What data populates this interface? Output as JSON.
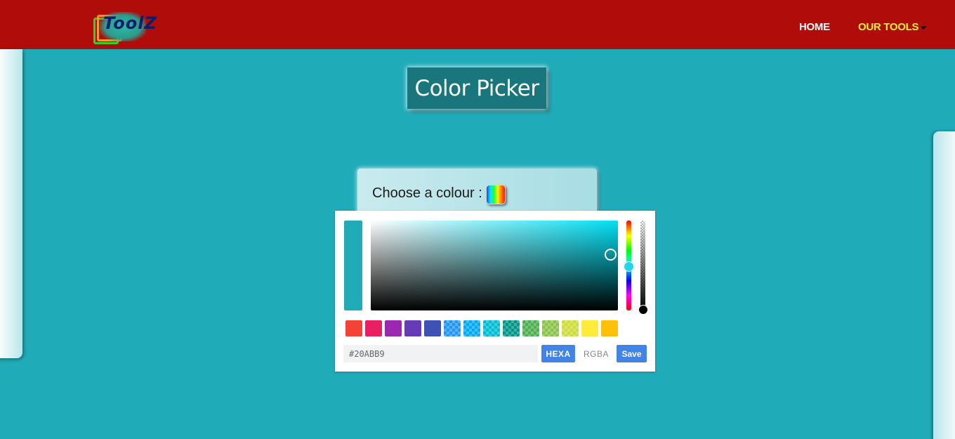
{
  "navbar": {
    "logo_text": "ToolZ",
    "links": [
      {
        "label": "HOME"
      },
      {
        "label": "OUR TOOLS"
      }
    ]
  },
  "page": {
    "title": "Color Picker"
  },
  "chooser": {
    "label": "Choose a colour :"
  },
  "picker": {
    "current_color": "#20ABB9",
    "hue_color": "#00e1f5",
    "hex_value": "#20ABB9",
    "modes": [
      {
        "label": "HEXA",
        "active": true
      },
      {
        "label": "RGBA",
        "active": false
      }
    ],
    "save_label": "Save",
    "swatches": [
      {
        "color": "#f44336",
        "translucent": false
      },
      {
        "color": "#e91e63",
        "translucent": false
      },
      {
        "color": "#9c27b0",
        "translucent": false
      },
      {
        "color": "#673ab7",
        "translucent": false
      },
      {
        "color": "#3f51b5",
        "translucent": false
      },
      {
        "color": "#2196f3",
        "translucent": true
      },
      {
        "color": "#03a9f4",
        "translucent": true
      },
      {
        "color": "#00bcd4",
        "translucent": true
      },
      {
        "color": "#009688",
        "translucent": true
      },
      {
        "color": "#4caf50",
        "translucent": true
      },
      {
        "color": "#8bc34a",
        "translucent": true
      },
      {
        "color": "#cddc39",
        "translucent": true
      },
      {
        "color": "#ffeb3b",
        "translucent": false
      },
      {
        "color": "#ffc107",
        "translucent": false
      }
    ]
  },
  "colors": {
    "background": "#20abb9",
    "navbar": "#b00c0a",
    "title_box": "#19767d",
    "accent": "#4283e7",
    "nav_active": "#f8ef2b"
  }
}
